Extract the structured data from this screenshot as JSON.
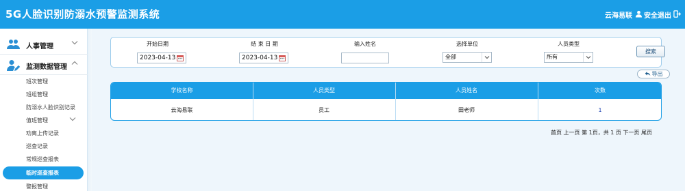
{
  "header": {
    "title": "5G人脸识别防溺水预警监测系统",
    "user_name": "云海易联",
    "logout_label": "安全退出"
  },
  "sidebar": {
    "groups": [
      {
        "label": "人事管理",
        "icon": "users-icon",
        "expanded": false
      },
      {
        "label": "监测数据管理",
        "icon": "user-edit-icon",
        "expanded": true
      }
    ],
    "items": [
      {
        "label": "班次管理"
      },
      {
        "label": "班组管理"
      },
      {
        "label": "防溺水人脸识别记录"
      },
      {
        "label": "值班管理"
      },
      {
        "label": "劝离上传记录"
      },
      {
        "label": "巡查记录"
      },
      {
        "label": "常规巡查报表"
      },
      {
        "label": "临时巡查报表",
        "active": true
      },
      {
        "label": "警报管理"
      }
    ]
  },
  "filters": {
    "start_date_label": "开始日期",
    "start_date_value": "2023-04-13",
    "end_date_label": "结 束 日 期",
    "end_date_value": "2023-04-13",
    "name_label": "输入姓名",
    "name_value": "",
    "unit_label": "选择单位",
    "unit_value": "全部",
    "type_label": "人员类型",
    "type_value": "所有",
    "search_label": "搜索"
  },
  "export_label": "导出",
  "table": {
    "columns": [
      "学校名称",
      "人员类型",
      "人员姓名",
      "次数"
    ],
    "rows": [
      {
        "school": "云海易联",
        "type": "员工",
        "name": "田老师",
        "count": "1"
      }
    ]
  },
  "pager": {
    "text": "首页 上一页 第 1页，共 1 页 下一页 尾页"
  },
  "colors": {
    "primary": "#1b9ee6",
    "background": "#eef6fc"
  }
}
